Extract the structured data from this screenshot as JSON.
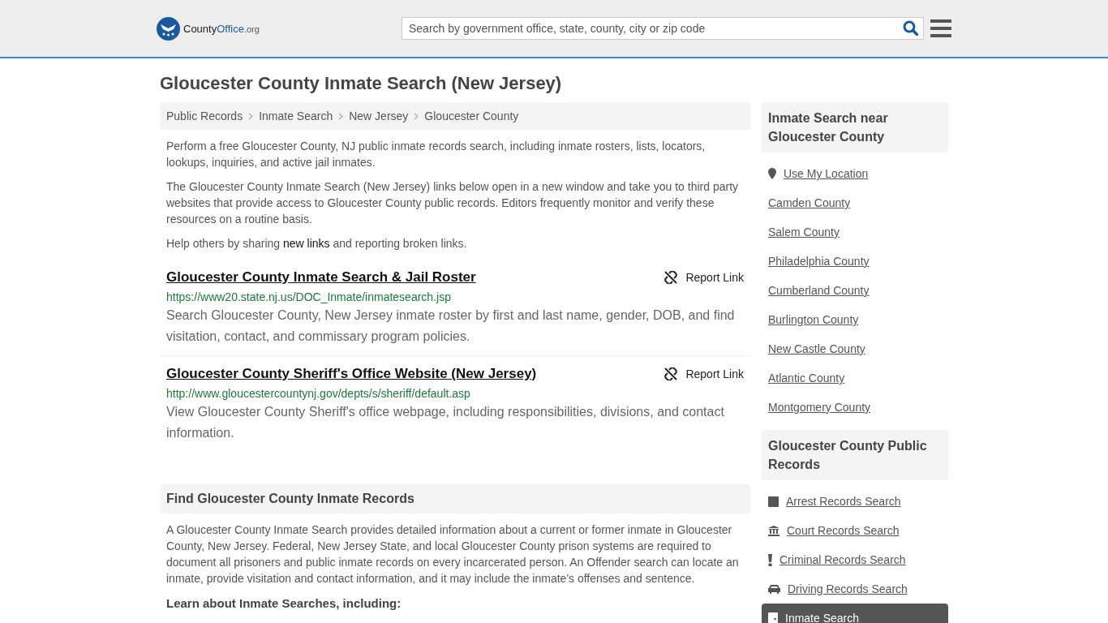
{
  "header": {
    "logo": {
      "name": "County",
      "accent": "Office",
      "suffix": ".org"
    },
    "search": {
      "placeholder": "Search by government office, state, county, city or zip code"
    }
  },
  "title": "Gloucester County Inmate Search (New Jersey)",
  "breadcrumbs": [
    "Public Records",
    "Inmate Search",
    "New Jersey",
    "Gloucester County"
  ],
  "intro": [
    "Perform a free Gloucester County, NJ public inmate records search, including inmate rosters, lists, locators, lookups, inquiries, and active jail inmates.",
    "The Gloucester County Inmate Search (New Jersey) links below open in a new window and take you to third party websites that provide access to Gloucester County public records. Editors frequently monitor and verify these resources on a routine basis."
  ],
  "share": {
    "before": "Help others by sharing",
    "link": "new links",
    "after": "and reporting broken links."
  },
  "links": [
    {
      "title": "Gloucester County Inmate Search & Jail Roster",
      "url": "https://www20.state.nj.us/DOC_Inmate/inmatesearch.jsp",
      "description": "Search Gloucester County, New Jersey inmate roster by first and last name, gender, DOB, and find visitation, contact, and commissary program policies.",
      "report": "Report Link"
    },
    {
      "title": "Gloucester County Sheriff's Office Website (New Jersey)",
      "url": "http://www.gloucestercountynj.gov/depts/s/sheriff/default.asp",
      "description": "View Gloucester County Sheriff's office webpage, including responsibilities, divisions, and contact information.",
      "report": "Report Link"
    }
  ],
  "find": {
    "heading": "Find Gloucester County Inmate Records",
    "body": "A Gloucester County Inmate Search provides detailed information about a current or former inmate in Gloucester County, New Jersey. Federal, New Jersey State, and local Gloucester County prison systems are required to document all prisoners and public inmate records on every incarcerated person. An Offender search can locate an inmate, provide visitation and contact information, and it may include the inmate's offenses and sentence.",
    "subheading": "Learn about Inmate Searches, including:"
  },
  "sidebar": [
    {
      "heading": "Inmate Search near Gloucester County",
      "items": [
        {
          "label": "Use My Location",
          "kind": "location",
          "selected": false
        },
        {
          "label": "Camden County",
          "kind": "plain",
          "selected": false
        },
        {
          "label": "Salem County",
          "kind": "plain",
          "selected": false
        },
        {
          "label": "Philadelphia County",
          "kind": "plain",
          "selected": false
        },
        {
          "label": "Cumberland County",
          "kind": "plain",
          "selected": false
        },
        {
          "label": "Burlington County",
          "kind": "plain",
          "selected": false
        },
        {
          "label": "New Castle County",
          "kind": "plain",
          "selected": false
        },
        {
          "label": "Atlantic County",
          "kind": "plain",
          "selected": false
        },
        {
          "label": "Montgomery County",
          "kind": "plain",
          "selected": false
        }
      ]
    },
    {
      "heading": "Gloucester County Public Records",
      "items": [
        {
          "label": "Arrest Records Search",
          "kind": "arrest",
          "selected": false
        },
        {
          "label": "Court Records Search",
          "kind": "court",
          "selected": false
        },
        {
          "label": "Criminal Records Search",
          "kind": "criminal",
          "selected": false
        },
        {
          "label": "Driving Records Search",
          "kind": "driving",
          "selected": false
        },
        {
          "label": "Inmate Search",
          "kind": "inmate",
          "selected": true
        }
      ]
    }
  ]
}
